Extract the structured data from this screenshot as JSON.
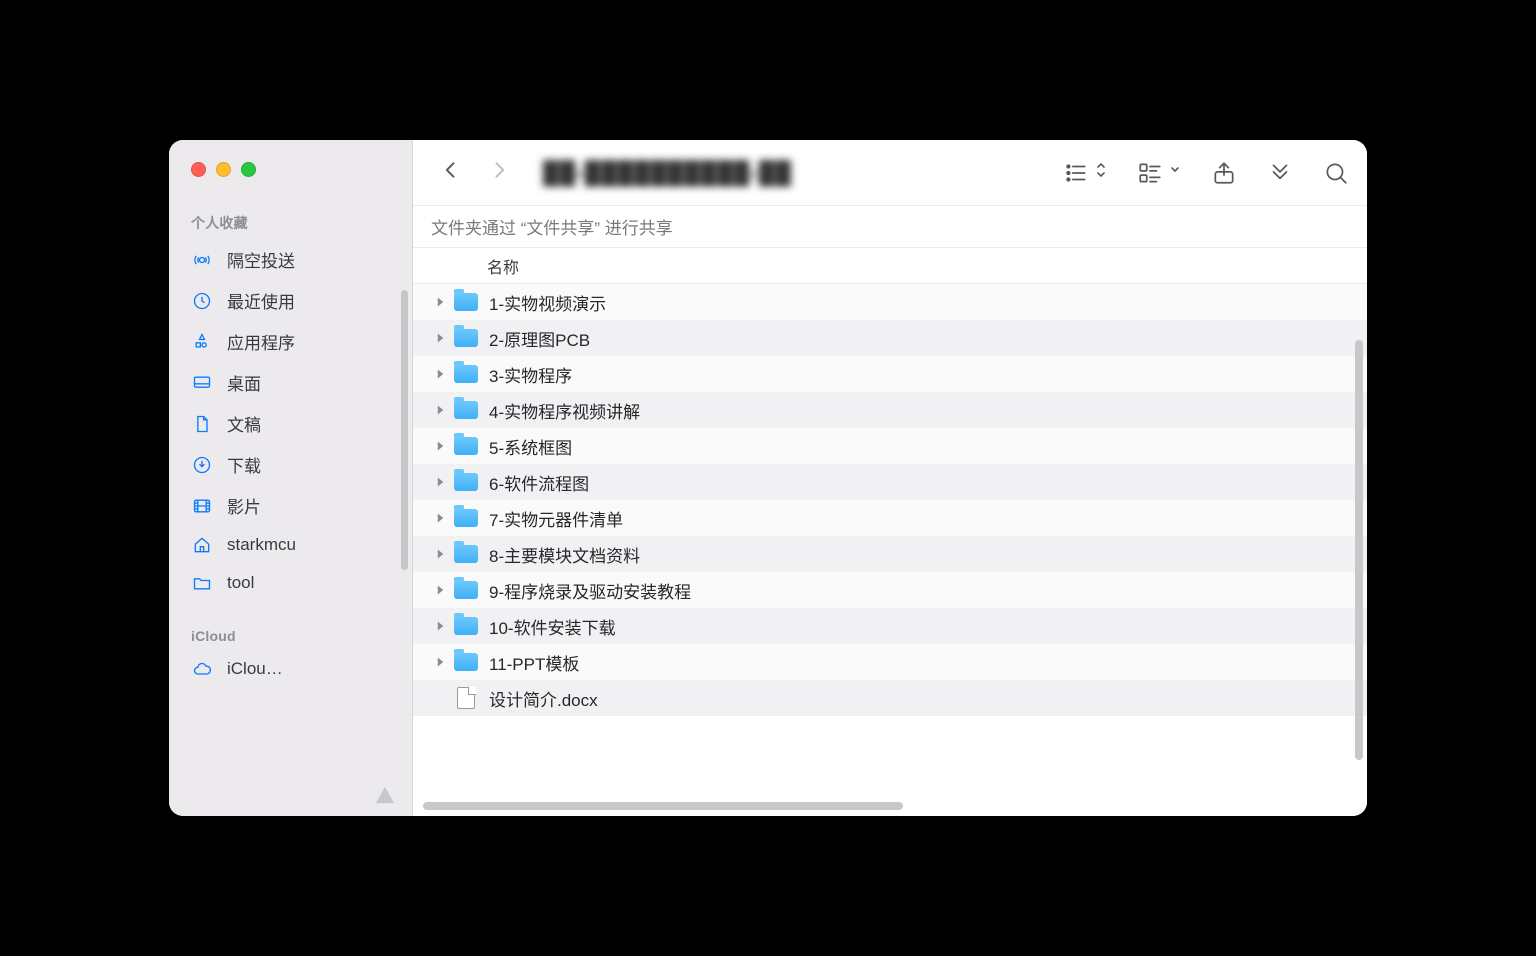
{
  "sidebar": {
    "sections": [
      {
        "title": "个人收藏",
        "items": [
          {
            "icon": "airdrop",
            "label": "隔空投送"
          },
          {
            "icon": "clock",
            "label": "最近使用"
          },
          {
            "icon": "apps",
            "label": "应用程序"
          },
          {
            "icon": "desktop",
            "label": "桌面"
          },
          {
            "icon": "doc",
            "label": "文稿"
          },
          {
            "icon": "download",
            "label": "下载"
          },
          {
            "icon": "movie",
            "label": "影片"
          },
          {
            "icon": "house",
            "label": "starkmcu"
          },
          {
            "icon": "folder",
            "label": "tool"
          }
        ]
      },
      {
        "title": "iCloud",
        "items": [
          {
            "icon": "cloud",
            "label": "iClou…"
          }
        ]
      }
    ]
  },
  "toolbar": {
    "title_obscured": "██-██████████-██"
  },
  "sharebar": {
    "text": "文件夹通过 “文件共享” 进行共享"
  },
  "columns": {
    "name": "名称"
  },
  "files": [
    {
      "type": "folder",
      "name": "1-实物视频演示"
    },
    {
      "type": "folder",
      "name": "2-原理图PCB"
    },
    {
      "type": "folder",
      "name": "3-实物程序"
    },
    {
      "type": "folder",
      "name": "4-实物程序视频讲解"
    },
    {
      "type": "folder",
      "name": "5-系统框图"
    },
    {
      "type": "folder",
      "name": "6-软件流程图"
    },
    {
      "type": "folder",
      "name": "7-实物元器件清单"
    },
    {
      "type": "folder",
      "name": "8-主要模块文档资料"
    },
    {
      "type": "folder",
      "name": "9-程序烧录及驱动安装教程"
    },
    {
      "type": "folder",
      "name": "10-软件安装下载"
    },
    {
      "type": "folder",
      "name": "11-PPT模板"
    },
    {
      "type": "file",
      "name": "设计简介.docx"
    }
  ]
}
